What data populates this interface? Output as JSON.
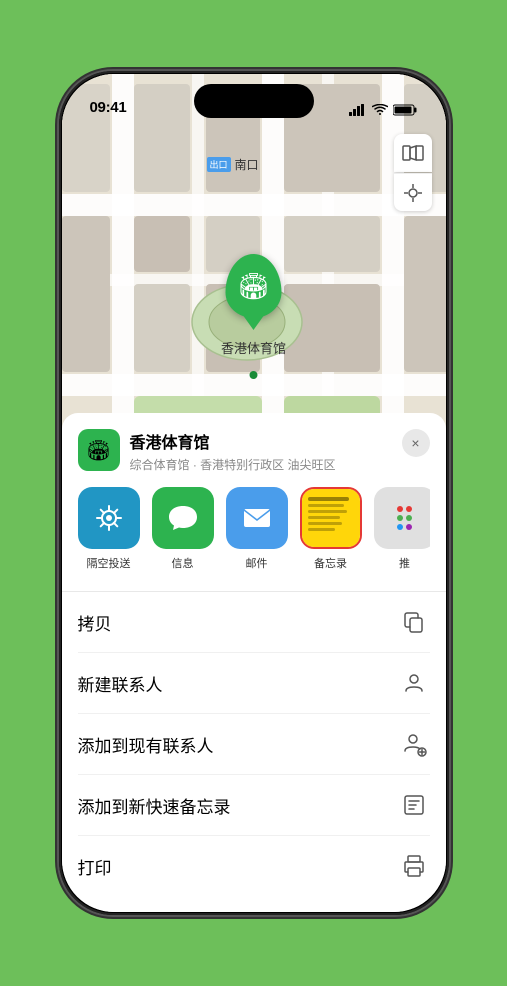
{
  "status_bar": {
    "time": "09:41",
    "signal_icon": "signal",
    "wifi_icon": "wifi",
    "battery_icon": "battery"
  },
  "map": {
    "south_gate_badge": "出口",
    "south_gate_label": "南口",
    "venue_marker_name": "香港体育馆",
    "map_icon": "🗺",
    "location_icon": "⊙"
  },
  "sheet": {
    "venue_name": "香港体育馆",
    "venue_subtitle": "综合体育馆 · 香港特别行政区 油尖旺区",
    "close_label": "×",
    "share_items": [
      {
        "id": "airdrop",
        "label": "隔空投送"
      },
      {
        "id": "messages",
        "label": "信息"
      },
      {
        "id": "mail",
        "label": "邮件"
      },
      {
        "id": "notes",
        "label": "备忘录"
      },
      {
        "id": "more",
        "label": "推"
      }
    ],
    "actions": [
      {
        "id": "copy",
        "label": "拷贝",
        "icon": "copy"
      },
      {
        "id": "new-contact",
        "label": "新建联系人",
        "icon": "person"
      },
      {
        "id": "add-existing",
        "label": "添加到现有联系人",
        "icon": "person-add"
      },
      {
        "id": "add-notes",
        "label": "添加到新快速备忘录",
        "icon": "note"
      },
      {
        "id": "print",
        "label": "打印",
        "icon": "print"
      }
    ]
  }
}
